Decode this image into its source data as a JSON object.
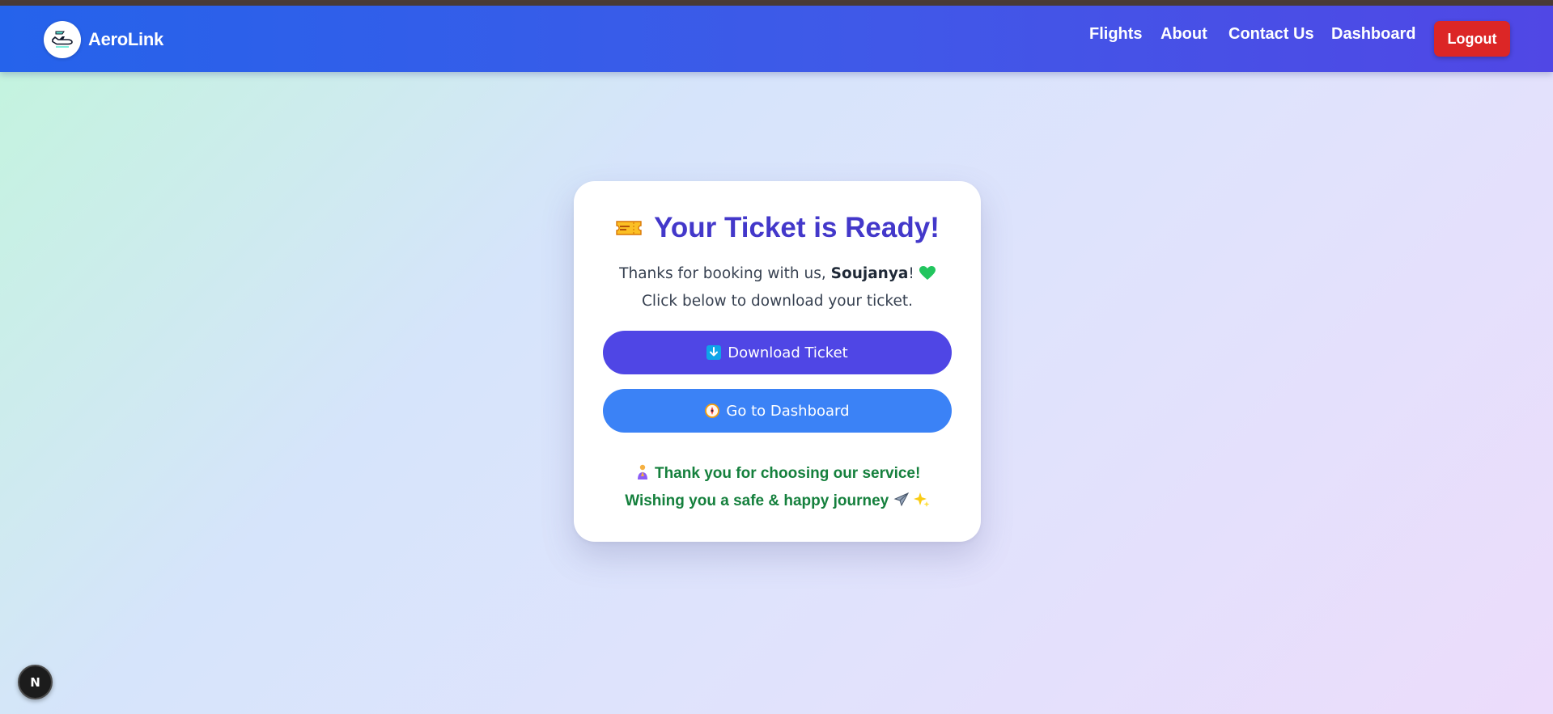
{
  "app": {
    "brand_name": "AeroLink",
    "logo_icon": "airplane-logo-icon"
  },
  "nav": {
    "links": [
      "Flights",
      "About",
      "Contact Us",
      "Dashboard"
    ],
    "logout_label": "Logout"
  },
  "card": {
    "title": "Your Ticket is Ready!",
    "title_icon": "ticket-icon",
    "greeting_prefix": "Thanks for booking with us, ",
    "user_name": "Soujanya",
    "greeting_suffix": "!",
    "instruction": "Click below to download your ticket.",
    "download_label": "Download Ticket",
    "dashboard_label": "Go to Dashboard",
    "thanks_line1": "Thank you for choosing our service!",
    "thanks_line2": "Wishing you a safe & happy journey"
  },
  "dev_badge": "N",
  "colors": {
    "nav_start": "#2563eb",
    "nav_end": "#5047e5",
    "logout": "#dc2626",
    "title": "#4338ca",
    "download_button": "#4f46e5",
    "dashboard_button": "#3b82f6",
    "thanks_text": "#15803d"
  }
}
